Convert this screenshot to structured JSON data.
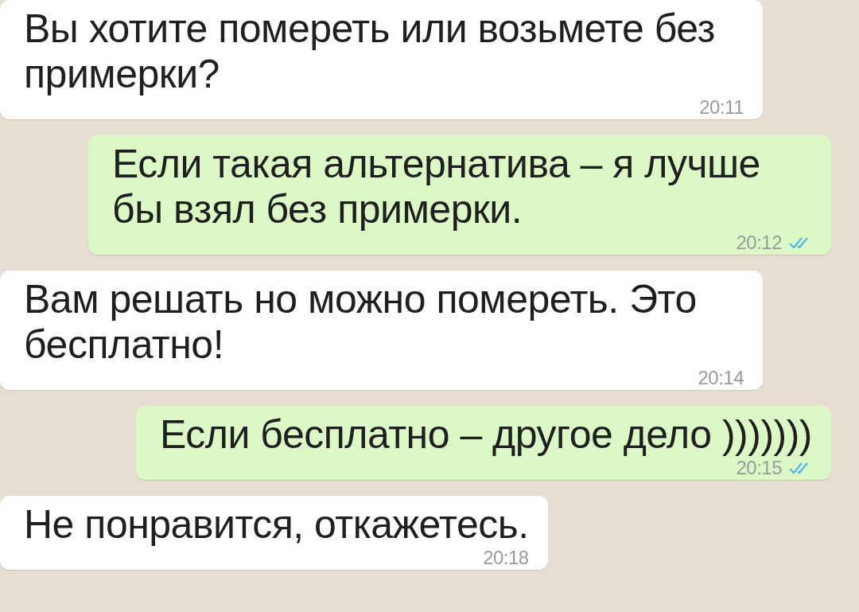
{
  "messages": [
    {
      "kind": "incoming",
      "text": "Вы хотите помереть или возьмете без примерки?",
      "time": "20:11"
    },
    {
      "kind": "outgoing",
      "text": "Если такая альтернатива – я лучше бы взял без примерки.",
      "time": "20:12",
      "read": true
    },
    {
      "kind": "incoming",
      "text": "Вам решать но можно помереть. Это бесплатно!",
      "time": "20:14"
    },
    {
      "kind": "outgoing",
      "text": "Если бесплатно – другое дело )))))))",
      "time": "20:15",
      "read": true
    },
    {
      "kind": "incoming",
      "text": "Не понравится, откажетесь.",
      "time": "20:18"
    }
  ]
}
